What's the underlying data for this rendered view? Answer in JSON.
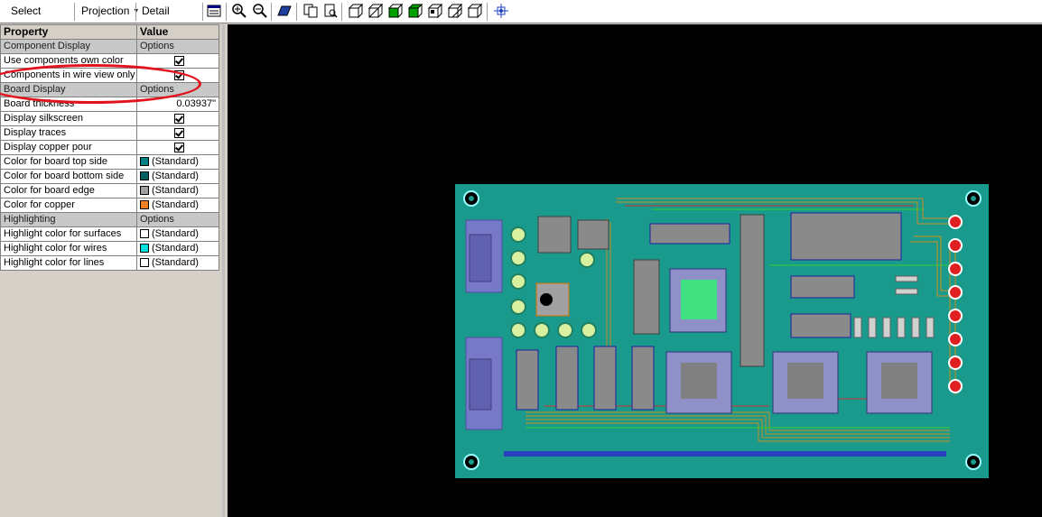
{
  "toolbar": {
    "select_view": "Select view",
    "projection": "Projection",
    "detail_level": "Detail level",
    "icons": [
      "properties-icon",
      "zoom-in-icon",
      "zoom-out-icon",
      "board-view-icon",
      "copy-icon",
      "print-preview-icon",
      "view-front-icon",
      "view-back-icon",
      "view-left-icon",
      "view-right-icon",
      "view-top-icon",
      "view-bottom-icon",
      "view-iso-icon",
      "center-view-icon"
    ]
  },
  "props": {
    "header": {
      "property": "Property",
      "value": "Value"
    },
    "rows": [
      {
        "type": "section",
        "label": "Component Display",
        "value": "Options"
      },
      {
        "type": "check",
        "label": "Use components own color"
      },
      {
        "type": "check",
        "label": "Components in wire view only"
      },
      {
        "type": "section",
        "label": "Board Display",
        "value": "Options"
      },
      {
        "type": "text",
        "label": "Board thickness",
        "value": "0.03937\""
      },
      {
        "type": "check",
        "label": "Display silkscreen"
      },
      {
        "type": "check",
        "label": "Display traces"
      },
      {
        "type": "check",
        "label": "Display copper pour"
      },
      {
        "type": "color",
        "label": "Color for board top side",
        "value": "(Standard)",
        "color": "#008080"
      },
      {
        "type": "color",
        "label": "Color for board bottom side",
        "value": "(Standard)",
        "color": "#006060"
      },
      {
        "type": "color",
        "label": "Color for board edge",
        "value": "(Standard)",
        "color": "#a0a0a0"
      },
      {
        "type": "color",
        "label": "Color for copper",
        "value": "(Standard)",
        "color": "#f08020"
      },
      {
        "type": "section",
        "label": "Highlighting",
        "value": "Options"
      },
      {
        "type": "color",
        "label": "Highlight color for surfaces",
        "value": "(Standard)",
        "color": "#ffffff"
      },
      {
        "type": "color",
        "label": "Highlight color for wires",
        "value": "(Standard)",
        "color": "#00e0e0"
      },
      {
        "type": "color",
        "label": "Highlight color for lines",
        "value": "(Standard)",
        "color": "#ffffff"
      }
    ]
  },
  "colors": {
    "board": "#1a9a8c",
    "annotation": "#e1141e"
  }
}
